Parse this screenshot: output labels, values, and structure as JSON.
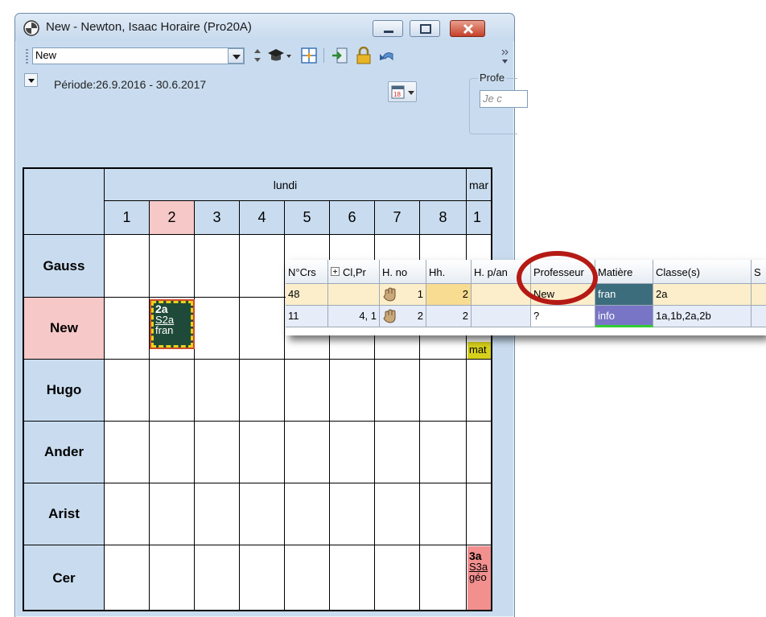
{
  "window": {
    "title": "New - Newton, Isaac  Horaire  (Pro20A)",
    "buttons": [
      "minimize",
      "maximize",
      "close"
    ]
  },
  "toolbar": {
    "combo_value": "New",
    "icons": [
      "spin-icon",
      "graduation-cap-icon",
      "grid-icon",
      "import-icon",
      "lock-icon",
      "undo-icon"
    ]
  },
  "period": {
    "label": "Période:26.9.2016 - 30.6.2017",
    "prof_label": "Profe",
    "prof_placeholder": "Je c",
    "calendar_day": "18"
  },
  "timetable": {
    "days": [
      "lundi",
      "mar"
    ],
    "hours": [
      "1",
      "2",
      "3",
      "4",
      "5",
      "6",
      "7",
      "8",
      "1"
    ],
    "rows": [
      "Gauss",
      "New",
      "Hugo",
      "Ander",
      "Arist",
      "Cer"
    ],
    "lessons": {
      "new_mon2": {
        "cls": "2a",
        "room": "S2a",
        "subject": "fran"
      },
      "cer_tue1": {
        "cls": "3a",
        "room": "S3a",
        "subject": "géo"
      },
      "new_tue1": {
        "subject": "mat"
      }
    }
  },
  "course_grid": {
    "headers": [
      "N°Crs",
      "Cl,Pr",
      "H. no",
      "Hh.",
      "H. p/an",
      "Professeur",
      "Matière",
      "Classe(s)",
      "S"
    ],
    "rows": [
      {
        "ncrs": "48",
        "cl_pr": "",
        "h_no": "1",
        "hh": "2",
        "h_pan": "",
        "prof": "New",
        "subject": "fran",
        "classes": "2a"
      },
      {
        "ncrs": "11",
        "cl_pr": "4, 1",
        "h_no": "2",
        "hh": "2",
        "h_pan": "",
        "prof": "?",
        "subject": "info",
        "classes": "1a,1b,2a,2b"
      }
    ]
  },
  "colors": {
    "window_bg": "#c9dcef",
    "highlight_pink": "#f7c8c8",
    "lesson_dark": "#1f4a3a",
    "lesson_border": "#e8d21a",
    "fran_bg": "#3c6d7d",
    "info_bg": "#7875c6",
    "row1_bg": "#fdeecb",
    "row2_bg": "#e6ecf8",
    "circle": "#b51a14"
  }
}
